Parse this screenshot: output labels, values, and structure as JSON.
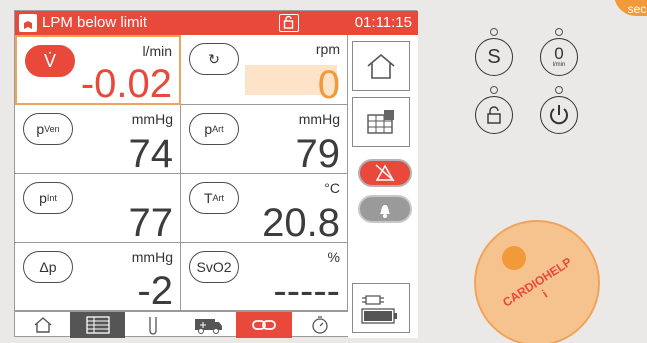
{
  "header": {
    "alarm_text": "LPM below limit",
    "clock": "01:11:15",
    "icons": [
      "lungs-icon",
      "lock-icon"
    ]
  },
  "cells": {
    "flow": {
      "button": "V̇",
      "unit": "l/min",
      "value": "-0.02"
    },
    "speed": {
      "button": "↻",
      "unit": "rpm",
      "value": "0"
    },
    "pven": {
      "button": "p",
      "button_sub": "Ven",
      "unit": "mmHg",
      "value": "74"
    },
    "part": {
      "button": "p",
      "button_sub": "Art",
      "unit": "mmHg",
      "value": "79"
    },
    "pint": {
      "button": "p",
      "button_sub": "Int",
      "unit": "",
      "value": "77"
    },
    "tart": {
      "button": "T",
      "button_sub": "Art",
      "unit": "°C",
      "value": "20.8"
    },
    "dp": {
      "button": "Δp",
      "unit": "mmHg",
      "value": "-2"
    },
    "svo2": {
      "button": "SvO2",
      "unit": "%",
      "value": "-----"
    }
  },
  "side_icons": [
    "home-icon",
    "layout-grid-icon",
    "alarm-mute-icon",
    "bell-icon",
    "battery-plug-icon"
  ],
  "bottom_icons": [
    "home-icon",
    "list-icon",
    "test-tube-icon",
    "ambulance-icon",
    "link-icon",
    "timer-icon"
  ],
  "hardware": {
    "s_label": "S",
    "zero_label": "0",
    "zero_sub": "l/min",
    "badge": "sec",
    "knob_text": "CARDIOHELP",
    "knob_sub": "i"
  },
  "colors": {
    "accent": "#e8493a",
    "orange": "#f29a3a",
    "selected": "#f0a45a"
  }
}
